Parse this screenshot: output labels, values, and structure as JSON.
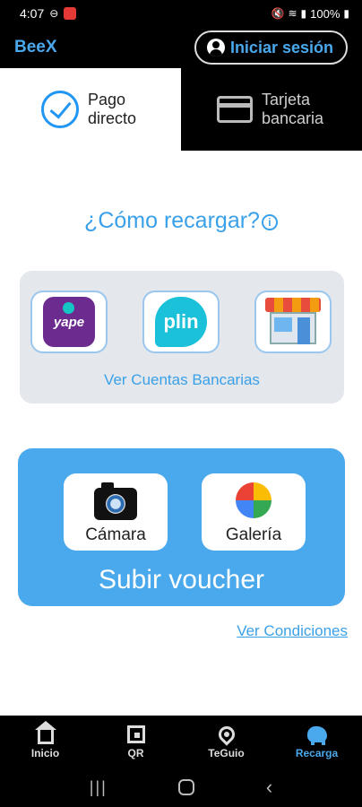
{
  "status_bar": {
    "time": "4:07",
    "battery": "100%"
  },
  "header": {
    "brand": "BeeX",
    "login_label": "Iniciar sesión"
  },
  "tabs": [
    {
      "line1": "Pago",
      "line2": "directo",
      "icon": "check-circle-icon",
      "active": true
    },
    {
      "line1": "Tarjeta",
      "line2": "bancaria",
      "icon": "credit-card-icon",
      "active": false
    }
  ],
  "howto": {
    "title": "¿Cómo recargar?",
    "info_icon": "i"
  },
  "methods": {
    "items": [
      {
        "name": "yape",
        "logo_text": "yape"
      },
      {
        "name": "plin",
        "logo_text": "plin"
      },
      {
        "name": "store",
        "logo_text": ""
      }
    ],
    "bank_link": "Ver Cuentas Bancarias"
  },
  "upload": {
    "camera_label": "Cámara",
    "gallery_label": "Galería",
    "title": "Subir voucher"
  },
  "conditions_link": "Ver Condiciones",
  "bottom_nav": [
    {
      "label": "Inicio",
      "icon": "home-icon",
      "active": false
    },
    {
      "label": "QR",
      "icon": "qr-icon",
      "active": false
    },
    {
      "label": "TeGuio",
      "icon": "location-pin-icon",
      "active": false
    },
    {
      "label": "Recarga",
      "icon": "piggy-bank-icon",
      "active": true
    }
  ],
  "colors": {
    "accent": "#4aa8ec",
    "dark": "#000000",
    "card_gray": "#e4e7ec"
  }
}
